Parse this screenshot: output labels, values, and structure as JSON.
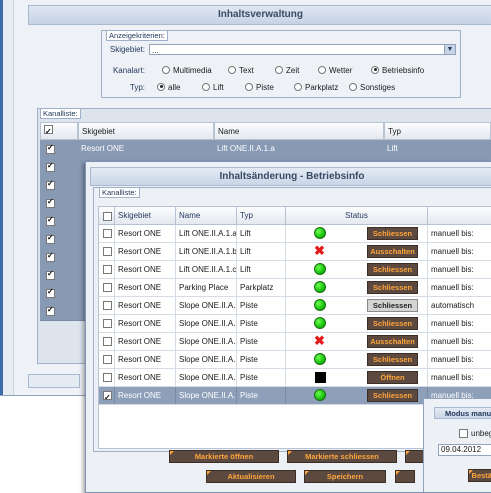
{
  "background": {
    "title": "Inhaltsverwaltung",
    "criteria": {
      "legend": "Anzeigekriterien:",
      "skigebiet_label": "Skigebiet:",
      "skigebiet_value": "...",
      "kanalart_label": "Kanalart:",
      "kanalart_options": [
        "Multimedia",
        "Text",
        "Zeit",
        "Wetter",
        "Betriebsinfo"
      ],
      "kanalart_selected": "Betriebsinfo",
      "typ_label": "Typ:",
      "typ_options": [
        "alle",
        "Lift",
        "Piste",
        "Parkplatz",
        "Sonstiges"
      ],
      "typ_selected": "alle"
    },
    "kanalliste": {
      "legend": "Kanalliste:",
      "columns": [
        "Skigebiet",
        "Name",
        "Typ"
      ],
      "first_row": {
        "skigebiet": "Resort ONE",
        "name": "Lift ONE.II.A.1.a",
        "typ": "Lift"
      },
      "row_count": 10
    }
  },
  "dialog": {
    "title": "Inhaltsänderung - Betriebsinfo",
    "legend": "Kanalliste:",
    "columns": [
      "Skigebiet",
      "Name",
      "Typ",
      "Status"
    ],
    "rows": [
      {
        "checked": false,
        "skigebiet": "Resort ONE",
        "name": "Lift ONE.II.A.1.a",
        "typ": "Lift",
        "status": "green",
        "action": "Schliessen",
        "mode": "manuell bis:",
        "selected": false
      },
      {
        "checked": false,
        "skigebiet": "Resort ONE",
        "name": "Lift ONE.II.A.1.b",
        "typ": "Lift",
        "status": "red",
        "action": "Ausschalten",
        "mode": "manuell bis:",
        "selected": false
      },
      {
        "checked": false,
        "skigebiet": "Resort ONE",
        "name": "Lift ONE.II.A.1.c",
        "typ": "Lift",
        "status": "green",
        "action": "Schliessen",
        "mode": "manuell bis:",
        "selected": false
      },
      {
        "checked": false,
        "skigebiet": "Resort ONE",
        "name": "Parking Place",
        "typ": "Parkplatz",
        "status": "green",
        "action": "Schliessen",
        "mode": "manuell bis:",
        "selected": false
      },
      {
        "checked": false,
        "skigebiet": "Resort ONE",
        "name": "Slope ONE.II.A...",
        "typ": "Piste",
        "status": "green",
        "action": "Schliessen",
        "mode": "automatisch",
        "selected": false,
        "light": true
      },
      {
        "checked": false,
        "skigebiet": "Resort ONE",
        "name": "Slope ONE.II.A...",
        "typ": "Piste",
        "status": "green",
        "action": "Schliessen",
        "mode": "manuell bis:",
        "selected": false
      },
      {
        "checked": false,
        "skigebiet": "Resort ONE",
        "name": "Slope ONE.II.A...",
        "typ": "Piste",
        "status": "red",
        "action": "Ausschalten",
        "mode": "manuell bis:",
        "selected": false
      },
      {
        "checked": false,
        "skigebiet": "Resort ONE",
        "name": "Slope ONE.II.A...",
        "typ": "Piste",
        "status": "green",
        "action": "Schliessen",
        "mode": "manuell bis:",
        "selected": false
      },
      {
        "checked": false,
        "skigebiet": "Resort ONE",
        "name": "Slope ONE.II.A...",
        "typ": "Piste",
        "status": "black",
        "action": "Öffnen",
        "mode": "manuell bis:",
        "selected": false
      },
      {
        "checked": true,
        "skigebiet": "Resort ONE",
        "name": "Slope ONE.II.A...",
        "typ": "Piste",
        "status": "green",
        "action": "Schliessen",
        "mode": "manuell bis:",
        "selected": true
      }
    ],
    "buttons": {
      "open_marked": "Markierte öffnen",
      "close_marked": "Markierte schliessen",
      "refresh": "Aktualisieren",
      "save": "Speichern",
      "confirm": "Bestät"
    }
  },
  "mode_panel": {
    "title": "Modus manu",
    "checkbox_label": "unbeg",
    "date_value": "09.04.2012"
  },
  "colors": {
    "header_gradient_top": "#e3eaf3",
    "selected_row": "#8d9fb9",
    "action_button_bg": "#5c4a40",
    "action_button_text": "#ffa53a",
    "status_green": "#18c00e",
    "status_red": "#e21b1b"
  }
}
